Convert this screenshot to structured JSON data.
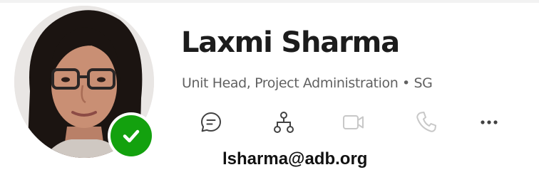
{
  "profile": {
    "name": "Laxmi Sharma",
    "title_line": "Unit Head, Project Administration • SG",
    "email": "lsharma@adb.org",
    "presence": "available"
  },
  "actions": [
    {
      "name": "chat",
      "icon": "chat-icon",
      "enabled": true
    },
    {
      "name": "org-chart",
      "icon": "org-chart-icon",
      "enabled": true
    },
    {
      "name": "video-call",
      "icon": "video-camera-icon",
      "enabled": false
    },
    {
      "name": "audio-call",
      "icon": "phone-icon",
      "enabled": false
    },
    {
      "name": "more-options",
      "icon": "more-horizontal-icon",
      "enabled": true
    }
  ],
  "colors": {
    "presence_available": "#13a10e",
    "text_primary": "#1c1c1c",
    "text_secondary": "#616161",
    "icon_enabled": "#424242",
    "icon_disabled": "#c8c8c8"
  }
}
